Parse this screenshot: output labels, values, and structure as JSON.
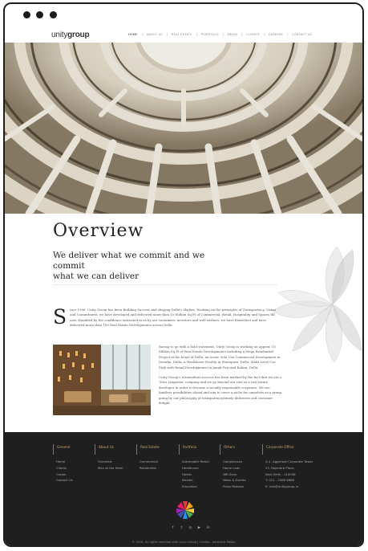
{
  "site": {
    "logo_light": "unity",
    "logo_bold": "group"
  },
  "nav": {
    "items": [
      "HOME",
      "ABOUT US",
      "REAL ESTATE",
      "PORTFOLIO",
      "MEDIA",
      "CLIENTS",
      "CAREERS",
      "CONTACT US"
    ],
    "active": "HOME"
  },
  "overview": {
    "title": "Overview",
    "tagline_line1": "We deliver what we commit and we commit",
    "tagline_line2": "what we can deliver",
    "intro_dropcap": "S",
    "intro_text": "ince 1996, Unity Group has been Building Success and shaping Delhi's Skyline. Working on the principles of Transparency, Vision and Commitment, we have developed and delivered more than 10 Million Sq Ft of Commercial, Retail, Hospitality and Spaces till now. Humbled by the confidence entrusted in us by our customers, investors and well wishers, we have flourished and have delivered more than 100 Real Estate Developments across Delhi.",
    "para2": "Raring to go with a bold statement, Unity Group is working on approx. 15 Million Sq Ft of Real Estate Developments including a Mega Residential Project in the heart of Delhi; an iconic 90m Use Commercial Development in Dwarka, Delhi, A Healthcare Facility in Pitampura, Delhi; Multi Level Car Park with Retail Developments in Janak Puri and Rohini, Delhi.",
    "para3": "Unity Group's tremendous success has been marked by the fact that we are a 'Zero Litigation' company and we go beyond our role as a real estate developer in order to become a socially responsible corporate. We see limitless possibilities ahead and aim to carve a niche for ourselves as a group, going by our philosophy of transparency/timely deliveries and customer delight."
  },
  "footer": {
    "columns": [
      {
        "heading": "General",
        "links": [
          "Home",
          "Clients",
          "Career",
          "Contact Us"
        ]
      },
      {
        "heading": "About Us",
        "links": [
          "Overview",
          "Man at the Helm"
        ]
      },
      {
        "heading": "Real Estate",
        "links": [
          "Commercial",
          "Residential"
        ]
      },
      {
        "heading": "Portfolio",
        "links": [
          "Automobile Retail",
          "Healthcare",
          "Hotels",
          "Mandis",
          "Education"
        ]
      },
      {
        "heading": "Others",
        "links": [
          "Compliances",
          "Home Loan",
          "NRI Zone",
          "News & Events",
          "Press Release"
        ]
      },
      {
        "heading": "Corporate Office",
        "links": [
          "G-1, Aggarwal Corporate Tower",
          "23, Rajendra Place,",
          "New Delhi - 110008",
          "T: 011 - 2586 8888",
          "E: info@unitygroup.in"
        ]
      }
    ],
    "social_icons": [
      "facebook-icon",
      "twitter-icon",
      "instagram-icon",
      "youtube-icon",
      "linkedin-icon"
    ],
    "social_glyphs": [
      "f",
      "t",
      "◎",
      "▶",
      "in"
    ],
    "copyright": "© 2016, All rights reserved with Unity Group   |   Credits - Addictive Media"
  },
  "colors": {
    "footer_bg": "#1f1f1f",
    "footer_heading": "#c8a36a"
  }
}
